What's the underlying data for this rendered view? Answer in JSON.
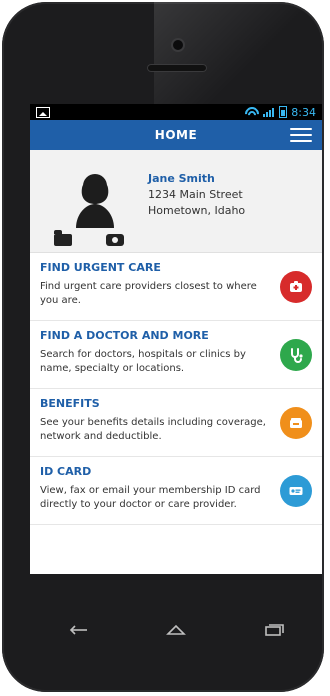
{
  "app": {
    "title": "HOME",
    "status_time": "8:34",
    "brand_color": "#1f5fa8",
    "accent_colors": {
      "urgent": "#d72b2b",
      "doctor": "#2ea84c",
      "benefits": "#f08f1b",
      "idcard": "#2d9bd6"
    }
  },
  "profile": {
    "name": "Jane Smith",
    "address_line1": "1234 Main Street",
    "address_line2": "Hometown, Idaho"
  },
  "list": [
    {
      "title": "FIND URGENT CARE",
      "desc": "Find urgent care providers closest to where you are.",
      "icon": "medical-kit-icon"
    },
    {
      "title": "FIND A DOCTOR AND MORE",
      "desc": "Search for doctors, hospitals or clinics by name, specialty or locations.",
      "icon": "stethoscope-icon"
    },
    {
      "title": "BENEFITS",
      "desc": "See your benefits details including coverage, network and deductible.",
      "icon": "benefits-box-icon"
    },
    {
      "title": "ID CARD",
      "desc": "View, fax or email your membership ID card directly to your doctor or care provider.",
      "icon": "id-card-icon"
    }
  ],
  "nav": {
    "back": "back-icon",
    "home": "home-icon",
    "recent": "recent-apps-icon"
  }
}
